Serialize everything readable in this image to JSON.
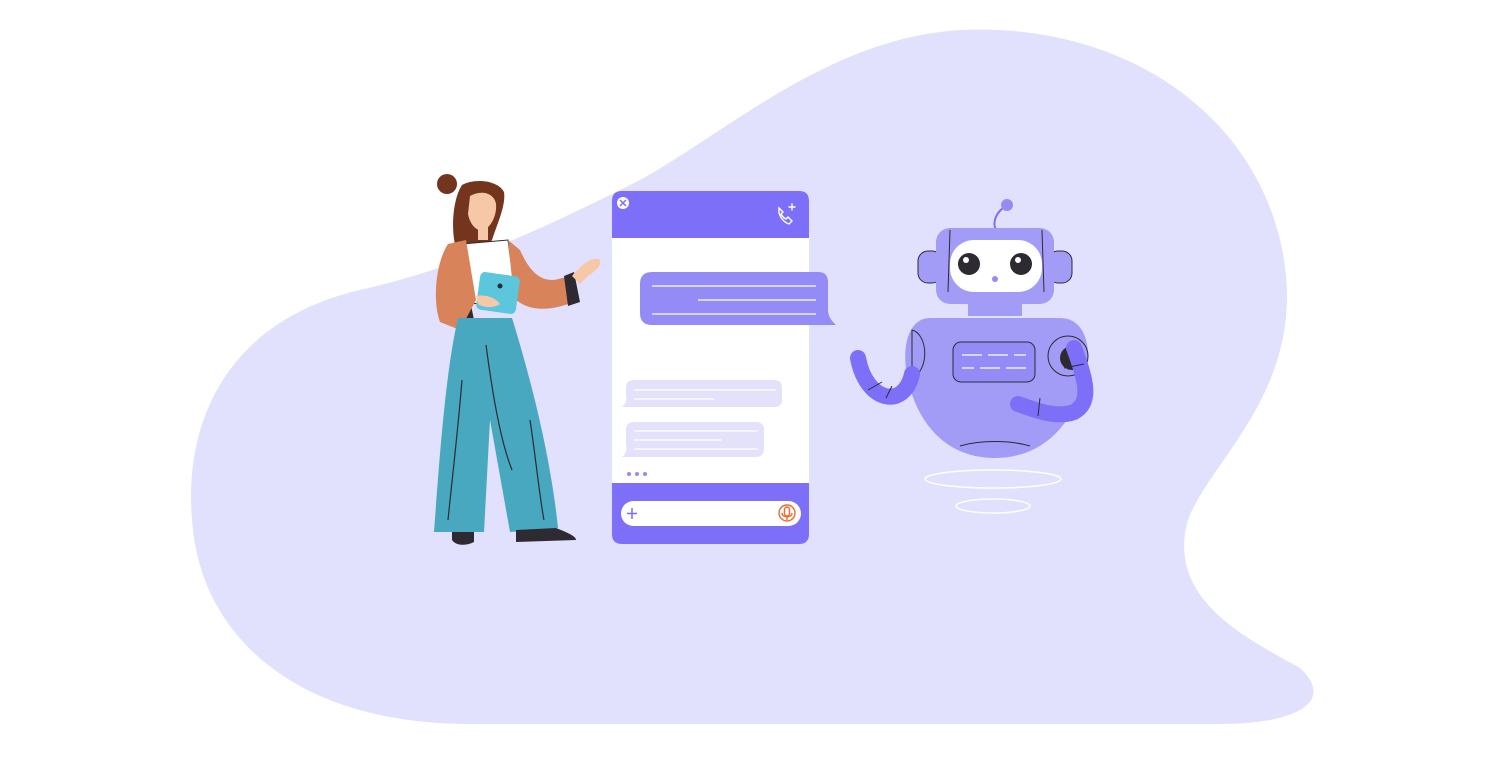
{
  "illustration": {
    "subject": "chatbot-conversation",
    "colors": {
      "backdrop": "#e2e1fd",
      "chat_purple": "#7d6ff8",
      "bubble_user": "#958bf7",
      "bubble_bot": "#e4e2fb",
      "robot_body": "#a39cf6",
      "robot_dark": "#2d2a32",
      "woman_jacket": "#d9835a",
      "woman_pants": "#47a8c0",
      "woman_hair": "#74351f",
      "woman_skin": "#f6c8a8",
      "tablet": "#5cc6dc",
      "mic_accent": "#ee6b2c"
    },
    "icons": {
      "chat_header_left": "close-icon",
      "chat_header_right": "phone-plus-icon",
      "composer_left": "plus-icon",
      "composer_right": "microphone-icon"
    },
    "chat": {
      "bot_messages": 2,
      "user_messages": 1,
      "typing_indicator": true
    }
  }
}
